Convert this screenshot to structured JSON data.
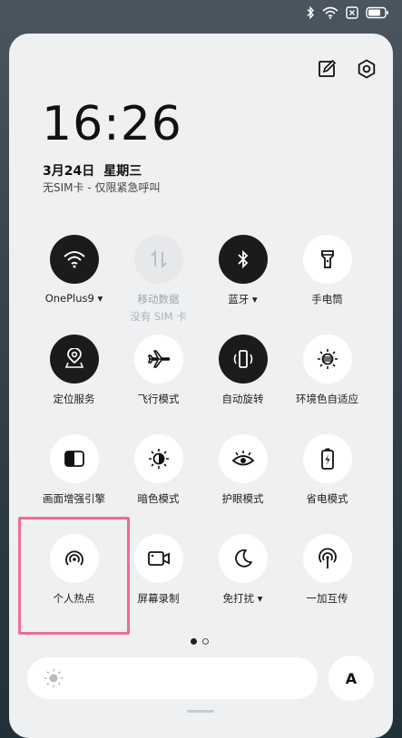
{
  "status_bar": {
    "icons": [
      "bluetooth-icon",
      "wifi-icon",
      "sim-x-icon",
      "battery-icon"
    ]
  },
  "panel": {
    "actions": [
      "edit-icon",
      "settings-icon"
    ],
    "time": "16:26",
    "date": "3月24日",
    "weekday": "星期三",
    "sim_status": "无SIM卡 - 仅限紧急呼叫"
  },
  "tiles": [
    {
      "label": "OnePlus9",
      "state": "on",
      "dropdown": true
    },
    {
      "label": "移动数据",
      "sub": "没有 SIM 卡",
      "state": "disabled"
    },
    {
      "label": "蓝牙",
      "state": "on",
      "dropdown": true
    },
    {
      "label": "手电筒",
      "state": "off"
    },
    {
      "label": "定位服务",
      "state": "on"
    },
    {
      "label": "飞行模式",
      "state": "off"
    },
    {
      "label": "自动旋转",
      "state": "on"
    },
    {
      "label": "环境色自适应",
      "state": "off"
    },
    {
      "label": "画面增强引擎",
      "state": "off"
    },
    {
      "label": "暗色模式",
      "state": "off"
    },
    {
      "label": "护眼模式",
      "state": "off"
    },
    {
      "label": "省电模式",
      "state": "off"
    },
    {
      "label": "个人热点",
      "state": "off"
    },
    {
      "label": "屏幕录制",
      "state": "off"
    },
    {
      "label": "免打扰",
      "state": "off",
      "dropdown": true
    },
    {
      "label": "一加互传",
      "state": "off"
    }
  ],
  "pager": {
    "pages": 2,
    "current": 1
  },
  "brightness": {
    "auto_label": "A"
  },
  "colors": {
    "highlight": "#f06b95",
    "active_tile": "#1b1b1b",
    "panel_bg": "#eef0f2"
  }
}
